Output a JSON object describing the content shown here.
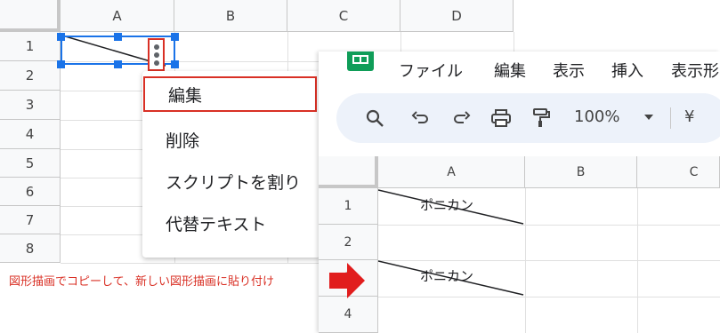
{
  "background_sheet": {
    "columns": [
      "A",
      "B",
      "C",
      "D"
    ],
    "rows": [
      "1",
      "2",
      "3",
      "4",
      "5",
      "6",
      "7",
      "8"
    ]
  },
  "context_menu": {
    "items": [
      {
        "label": "編集",
        "highlighted": true
      },
      {
        "label": "削除",
        "highlighted": false
      },
      {
        "label": "スクリプトを割り",
        "highlighted": false
      },
      {
        "label": "代替テキスト",
        "highlighted": false
      }
    ]
  },
  "caption": "図形描画でコピーして、新しい図形描画に貼り付け",
  "foreground_window": {
    "menubar": [
      "ファイル",
      "編集",
      "表示",
      "挿入",
      "表示形"
    ],
    "toolbar": {
      "icons": [
        "search-icon",
        "undo-icon",
        "redo-icon",
        "print-icon",
        "paint-format-icon"
      ],
      "zoom": "100%",
      "currency": "¥"
    },
    "columns": [
      "A",
      "B",
      "C"
    ],
    "rows": [
      "1",
      "2",
      "3",
      "4"
    ],
    "shapes": [
      {
        "text": "ポニカン"
      },
      {
        "text": "ポニカン"
      }
    ]
  },
  "colors": {
    "highlight_red": "#d93025",
    "selection_blue": "#1a73e8",
    "sheets_green": "#0f9d58",
    "toolbar_bg": "#edf2fa"
  }
}
